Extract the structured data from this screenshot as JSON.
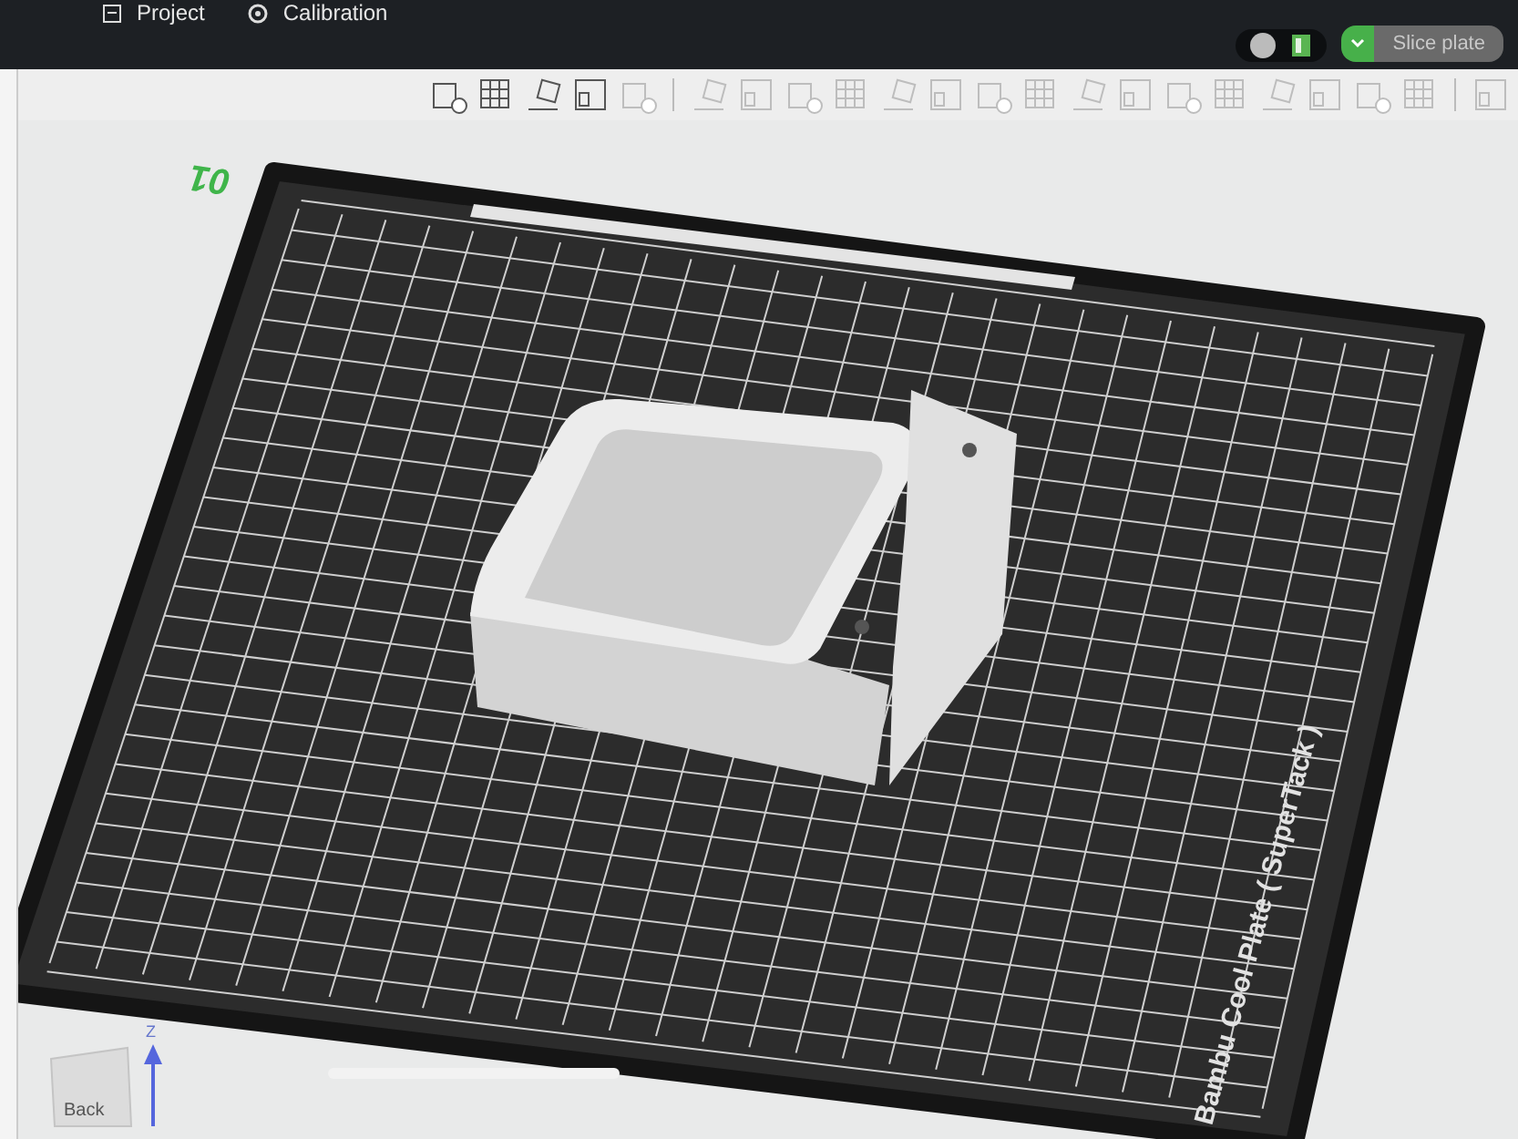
{
  "top_tabs": [
    {
      "label": "Project"
    },
    {
      "label": "Calibration"
    }
  ],
  "slice_button": {
    "label": "Slice plate"
  },
  "plate": {
    "number": "01",
    "name": "Bambu Cool Plate ( SuperTack )"
  },
  "view_cube": {
    "face_label": "Back",
    "axis_label": "Z"
  }
}
